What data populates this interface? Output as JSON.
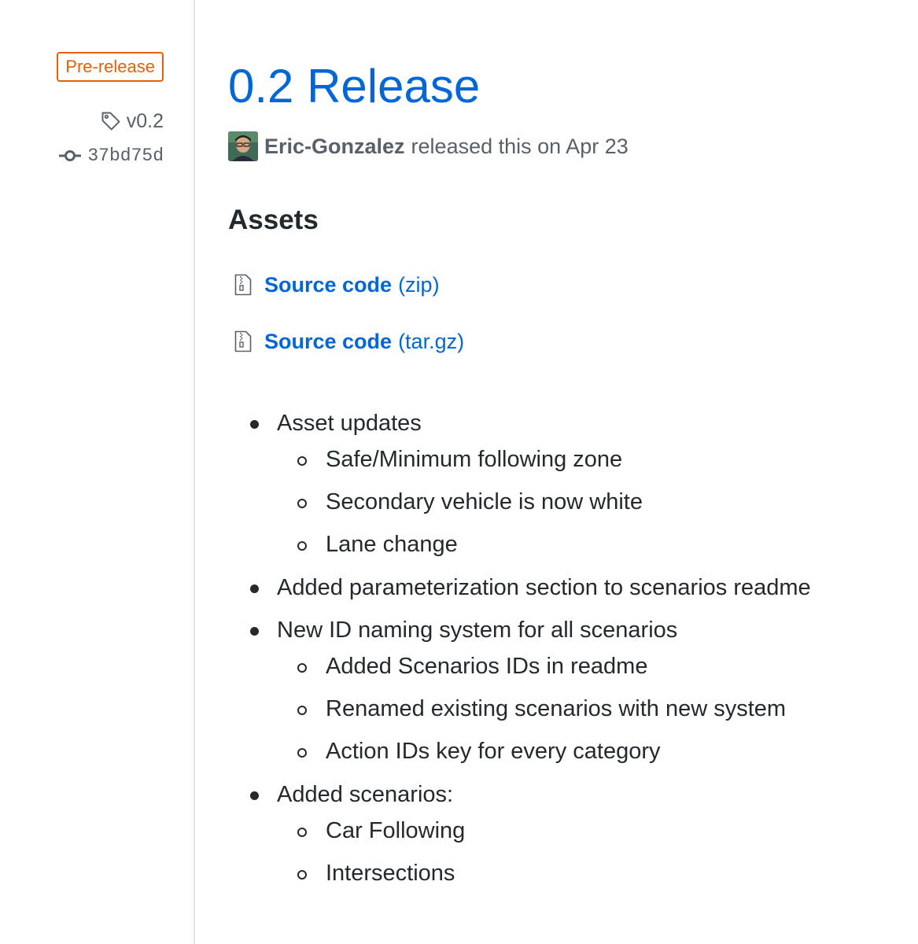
{
  "sidebar": {
    "badge": "Pre-release",
    "tag": "v0.2",
    "commit": "37bd75d"
  },
  "release": {
    "title": "0.2 Release",
    "author": "Eric-Gonzalez",
    "released_text": "released this on Apr 23"
  },
  "assets": {
    "heading": "Assets",
    "items": [
      {
        "name": "Source code",
        "ext": "(zip)"
      },
      {
        "name": "Source code",
        "ext": "(tar.gz)"
      }
    ]
  },
  "notes": {
    "items": [
      {
        "text": "Asset updates",
        "children": [
          "Safe/Minimum following zone",
          "Secondary vehicle is now white",
          "Lane change"
        ]
      },
      {
        "text": "Added parameterization section to scenarios readme",
        "children": []
      },
      {
        "text": "New ID naming system for all scenarios",
        "children": [
          "Added Scenarios IDs in readme",
          "Renamed existing scenarios with new system",
          "Action IDs key for every category"
        ]
      },
      {
        "text": "Added scenarios:",
        "children": [
          "Car Following",
          "Intersections"
        ]
      }
    ]
  },
  "colors": {
    "link": "#0366d6",
    "prerelease": "#e36209",
    "muted": "#586069",
    "text": "#24292e"
  }
}
